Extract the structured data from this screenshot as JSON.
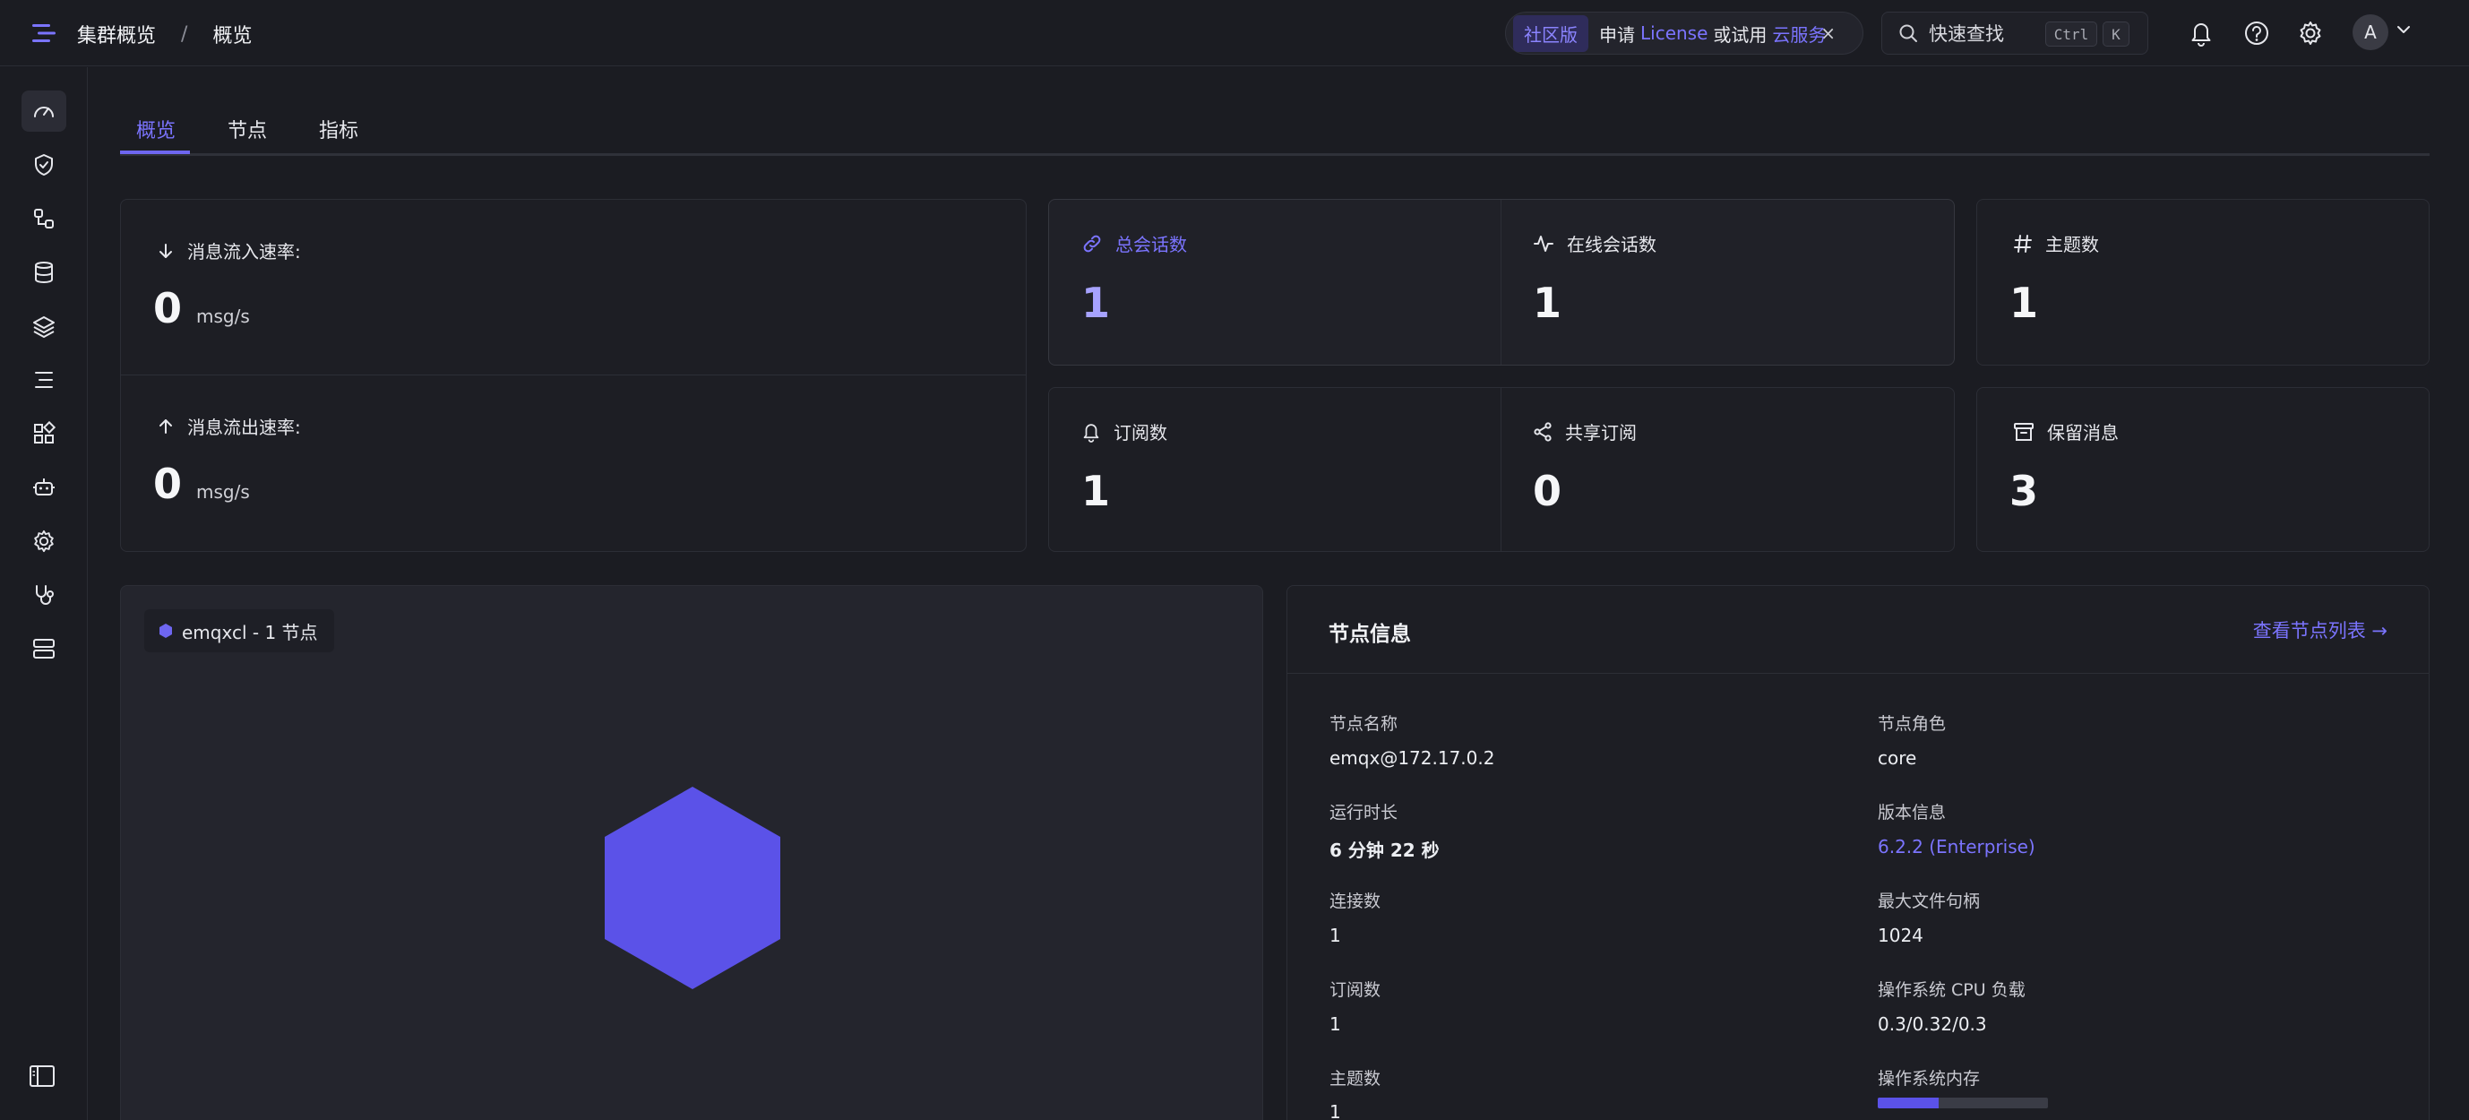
{
  "header": {
    "breadcrumb_root": "集群概览",
    "breadcrumb_sep": "/",
    "breadcrumb_current": "概览",
    "promo": {
      "badge": "社区版",
      "text1": "申请",
      "link1": "License",
      "text2": "或试用",
      "link2": "云服务",
      "close": "×"
    },
    "search": {
      "placeholder": "快速查找",
      "kbd1": "Ctrl",
      "kbd2": "K"
    },
    "avatar": "A",
    "icons": [
      "bell-icon",
      "help-icon",
      "settings-icon",
      "chevron-down-icon"
    ]
  },
  "sidebar": {
    "items": [
      "dashboard-icon",
      "shield-icon",
      "flow-icon",
      "database-icon",
      "layers-icon",
      "list-icon",
      "extensions-icon",
      "robot-icon",
      "gear-icon",
      "stethoscope-icon",
      "server-icon"
    ],
    "active_index": 0,
    "collapse": "sidebar-collapse-icon"
  },
  "tabs": [
    {
      "label": "概览",
      "active": true
    },
    {
      "label": "节点",
      "active": false
    },
    {
      "label": "指标",
      "active": false
    }
  ],
  "rates": {
    "in": {
      "label": "消息流入速率:",
      "value": "0",
      "unit": "msg/s"
    },
    "out": {
      "label": "消息流出速率:",
      "value": "0",
      "unit": "msg/s"
    }
  },
  "stats": {
    "total_sessions": {
      "label": "总会话数",
      "value": "1"
    },
    "online_sessions": {
      "label": "在线会话数",
      "value": "1"
    },
    "topics": {
      "label": "主题数",
      "value": "1"
    },
    "subscriptions": {
      "label": "订阅数",
      "value": "1"
    },
    "shared_subs": {
      "label": "共享订阅",
      "value": "0"
    },
    "retained": {
      "label": "保留消息",
      "value": "3"
    }
  },
  "topology": {
    "cluster": "emqxcl - 1 节点"
  },
  "node_info": {
    "title": "节点信息",
    "link": "查看节点列表 →",
    "fields": {
      "name_label": "节点名称",
      "name_value": "emqx@172.17.0.2",
      "role_label": "节点角色",
      "role_value": "core",
      "uptime_label": "运行时长",
      "uptime_value": "6 分钟 22 秒",
      "version_label": "版本信息",
      "version_value": "6.2.2 (Enterprise)",
      "conn_label": "连接数",
      "conn_value": "1",
      "maxfd_label": "最大文件句柄",
      "maxfd_value": "1024",
      "subs_label": "订阅数",
      "subs_value": "1",
      "cpu_label": "操作系统 CPU 负载",
      "cpu_value": "0.3/0.32/0.3",
      "topics_label": "主题数",
      "topics_value": "1",
      "mem_label": "操作系统内存",
      "mem_fraction": 0.36
    }
  },
  "colors": {
    "accent": "#6e66f0",
    "background": "#1b1c22",
    "card": "#1d1e24"
  }
}
